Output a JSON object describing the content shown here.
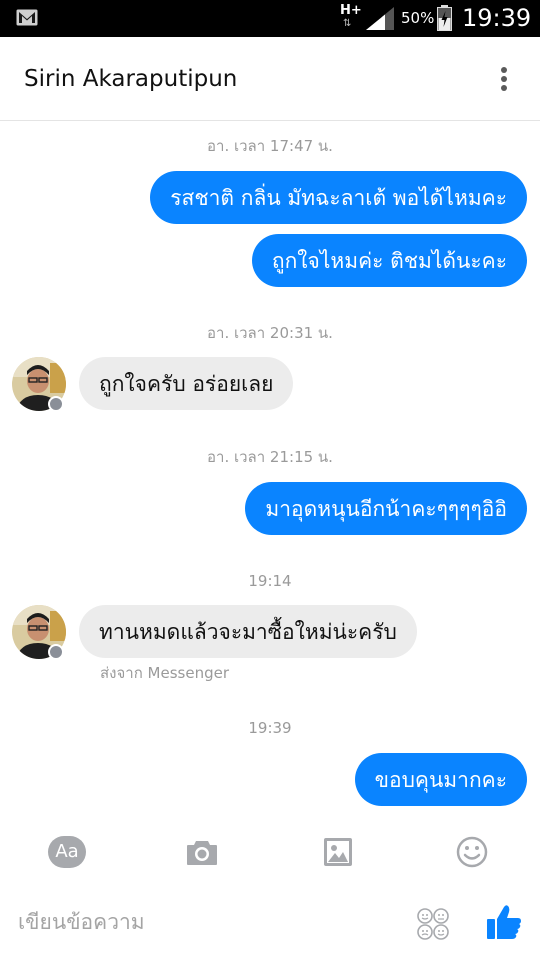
{
  "status_bar": {
    "network": "H+",
    "battery_percent": "50%",
    "time": "19:39",
    "icons": [
      "gmail-icon",
      "data-arrows-icon",
      "signal-icon",
      "battery-icon"
    ]
  },
  "header": {
    "contact_name": "Sirin Akaraputipun",
    "menu_icon": "more-vertical-icon"
  },
  "messages": {
    "ts1": "อา. เวลา 17:47 น.",
    "m1": "รสชาติ กลิ่น มัทฉะลาเต้ พอได้ไหมคะ",
    "m2": "ถูกใจไหมค่ะ ติชมได้นะคะ",
    "ts2": "อา. เวลา 20:31 น.",
    "m3": "ถูกใจครับ อร่อยเลย",
    "ts3": "อา. เวลา 21:15 น.",
    "m4": "มาอุดหนุนอีกน้าคะๆๆๆๆอิอิ",
    "ts4": "19:14",
    "m5": "ทานหมดแล้วจะมาซื้อใหม่น่ะครับ",
    "sent_from": "ส่งจาก Messenger",
    "ts5": "19:39",
    "m6": "ขอบคุนมากคะ"
  },
  "composer": {
    "aa_label": "Aa",
    "placeholder": "เขียนข้อความ",
    "icons": [
      "camera-icon",
      "image-icon",
      "emoji-icon",
      "stickers-icon",
      "like-thumb-icon"
    ]
  },
  "colors": {
    "outgoing_bubble": "#0a84ff",
    "incoming_bubble": "#ececec",
    "accent": "#0a84ff"
  }
}
